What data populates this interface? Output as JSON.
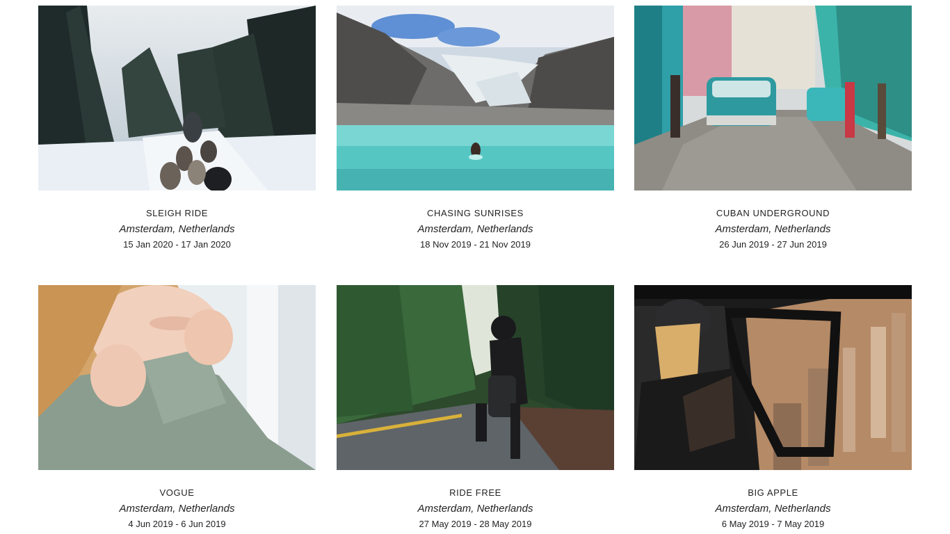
{
  "trips": [
    {
      "title": "SLEIGH RIDE",
      "location": "Amsterdam, Netherlands",
      "dates": "15 Jan 2020 - 17 Jan 2020",
      "image": "snowy-forest-dog-sled"
    },
    {
      "title": "CHASING SUNRISES",
      "location": "Amsterdam, Netherlands",
      "dates": "18 Nov 2019 - 21 Nov 2019",
      "image": "glacier-lake-swimmer"
    },
    {
      "title": "CUBAN UNDERGROUND",
      "location": "Amsterdam, Netherlands",
      "dates": "26 Jun 2019 - 27 Jun 2019",
      "image": "havana-street-classic-car"
    },
    {
      "title": "VOGUE",
      "location": "Amsterdam, Netherlands",
      "dates": "4 Jun 2019 - 6 Jun 2019",
      "image": "woman-knit-sweater"
    },
    {
      "title": "RIDE FREE",
      "location": "Amsterdam, Netherlands",
      "dates": "27 May 2019 - 28 May 2019",
      "image": "forest-road-motorcycle"
    },
    {
      "title": "BIG APPLE",
      "location": "Amsterdam, Netherlands",
      "dates": "6 May 2019 - 7 May 2019",
      "image": "helicopter-city-view"
    }
  ]
}
